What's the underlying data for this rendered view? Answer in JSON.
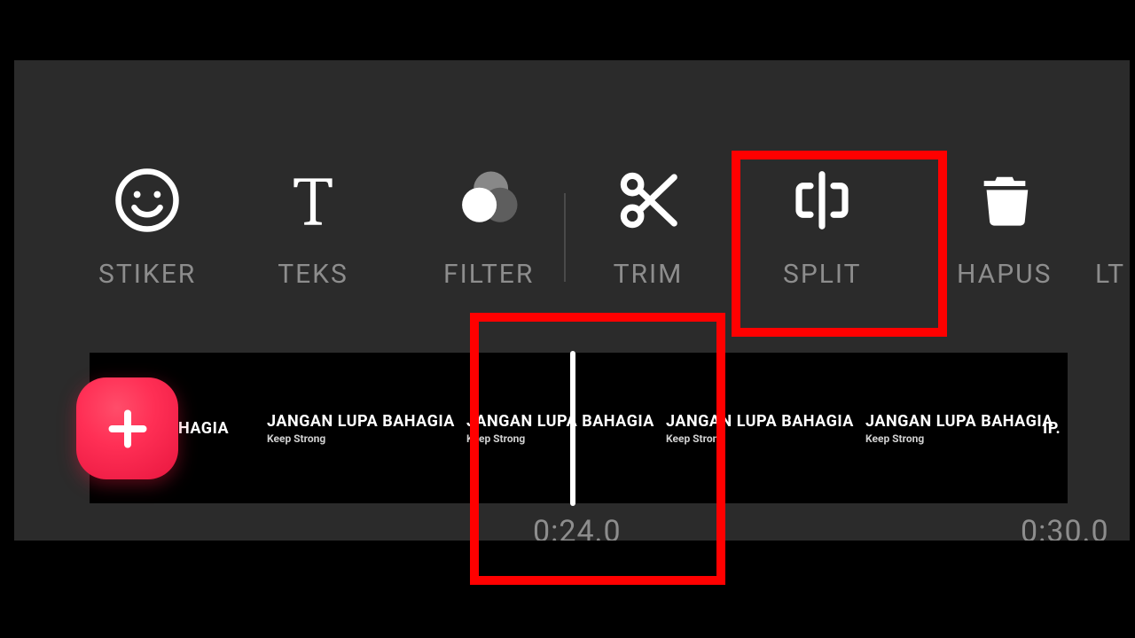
{
  "toolbar": {
    "stiker": "STIKER",
    "teks": "TEKS",
    "filter": "FILTER",
    "trim": "TRIM",
    "split": "SPLIT",
    "hapus": "HAPUS",
    "lt_e": "LT E"
  },
  "timeline": {
    "clip_title": "JANGAN LUPA BAHAGIA",
    "clip_sub": "Keep Strong",
    "clip_title_partial_left": "HAGIA",
    "clip_title_partial_right": "IP.",
    "time_current": "0:24.0",
    "time_end": "0:30.0"
  },
  "highlight": {
    "primary": "split-button",
    "secondary": "timeline-playhead"
  }
}
